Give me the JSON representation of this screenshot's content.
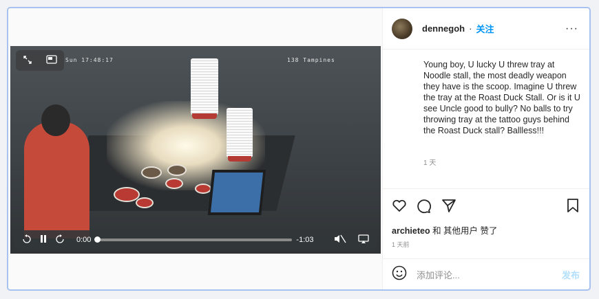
{
  "video": {
    "overlay_timestamp": "Sun 17:48:17",
    "overlay_location": "138 Tampines",
    "current_time": "0:00",
    "remaining_time": "-1:03",
    "progress": 0.0
  },
  "header": {
    "username": "dennegoh",
    "separator": "·",
    "follow_label": "关注",
    "more_label": "···"
  },
  "caption": {
    "text": "Young boy, U lucky U threw tray at Noodle stall, the most deadly weapon they have is the scoop. Imagine U threw the tray at the Roast Duck Stall. Or is it U see Uncle good to bully? No balls to try throwing tray at the tattoo guys behind the Roast Duck stall? Ballless!!!",
    "time_ago": "1 天"
  },
  "likes": {
    "user": "archieteo",
    "rest": " 和 其他用户 赞了",
    "time_ago": "1 天前"
  },
  "comment": {
    "placeholder": "添加评论...",
    "post_label": "发布"
  },
  "icons": [
    "expand-icon",
    "pip-icon",
    "rewind-15-icon",
    "pause-icon",
    "forward-15-icon",
    "mute-icon",
    "airplay-icon",
    "heart-icon",
    "comment-icon",
    "share-icon",
    "bookmark-icon",
    "emoji-icon"
  ],
  "colors": {
    "accent": "#0095f6",
    "frame_border": "#a8c2f0"
  }
}
